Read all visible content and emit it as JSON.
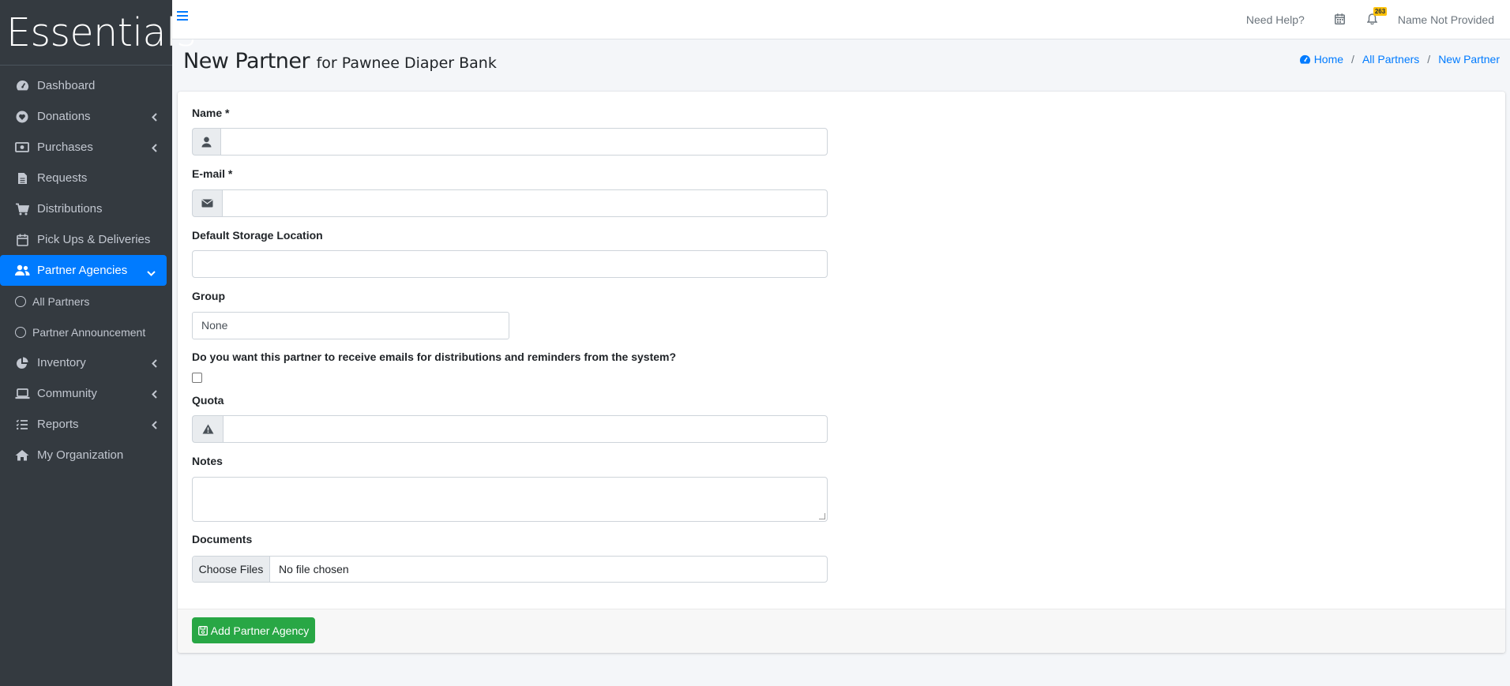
{
  "brand": {
    "name": "Essentials"
  },
  "sidebar": {
    "items": [
      {
        "label": "Dashboard",
        "icon": "dashboard-icon",
        "chevron": false
      },
      {
        "label": "Donations",
        "icon": "heart-icon",
        "chevron": true
      },
      {
        "label": "Purchases",
        "icon": "money-icon",
        "chevron": true
      },
      {
        "label": "Requests",
        "icon": "file-icon",
        "chevron": false
      },
      {
        "label": "Distributions",
        "icon": "cart-icon",
        "chevron": false
      },
      {
        "label": "Pick Ups & Deliveries",
        "icon": "calendar-icon",
        "chevron": false
      },
      {
        "label": "Partner Agencies",
        "icon": "users-icon",
        "chevron": true,
        "active": true
      }
    ],
    "sub_items": [
      {
        "label": "All Partners"
      },
      {
        "label": "Partner Announcement"
      }
    ],
    "items_after": [
      {
        "label": "Inventory",
        "icon": "pie-chart-icon",
        "chevron": true
      },
      {
        "label": "Community",
        "icon": "laptop-icon",
        "chevron": true
      },
      {
        "label": "Reports",
        "icon": "list-icon",
        "chevron": true
      },
      {
        "label": "My Organization",
        "icon": "home-icon",
        "chevron": false
      }
    ]
  },
  "topbar": {
    "help": "Need Help?",
    "notification_count": "263",
    "user_name": "Name Not Provided"
  },
  "header": {
    "title": "New Partner",
    "subtitle": "for Pawnee Diaper Bank"
  },
  "breadcrumb": {
    "home": "Home",
    "all_partners": "All Partners",
    "current": "New Partner"
  },
  "form": {
    "name_label": "Name *",
    "email_label": "E-mail *",
    "storage_label": "Default Storage Location",
    "group_label": "Group",
    "group_value": "None",
    "emails_label": "Do you want this partner to receive emails for distributions and reminders from the system?",
    "quota_label": "Quota",
    "notes_label": "Notes",
    "documents_label": "Documents",
    "choose_files": "Choose Files",
    "no_file": "No file chosen",
    "submit_label": "Add Partner Agency"
  },
  "colors": {
    "sidebar_bg": "#343a40",
    "active": "#007bff",
    "submit": "#28a745",
    "badge": "#ffc107"
  }
}
